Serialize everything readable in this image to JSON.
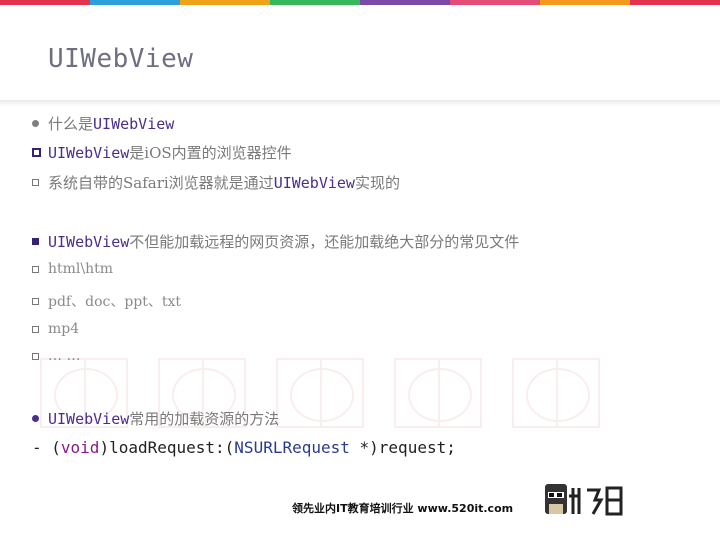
{
  "topbar_colors": [
    "#e5334f",
    "#2ea0d9",
    "#f0a21b",
    "#35b75a",
    "#7a4aa8",
    "#e44c78",
    "#f39a1e",
    "#e5334f"
  ],
  "slide": {
    "title": "UIWebView",
    "items": [
      {
        "prefix": "什么是",
        "code": "UIWebView",
        "suffix": ""
      },
      {
        "prefix": "",
        "code": "UIWebView",
        "suffix": "是iOS内置的浏览器控件"
      },
      {
        "prefix": "系统自带的Safari浏览器就是通过",
        "code": "UIWebView",
        "suffix": "实现的"
      },
      {
        "prefix": "",
        "code": "UIWebView",
        "suffix": "不但能加载远程的网页资源，还能加载绝大部分的常见文件"
      },
      {
        "text": "html\\htm"
      },
      {
        "text": "pdf、doc、ppt、txt"
      },
      {
        "text": "mp4"
      },
      {
        "text": "… …"
      },
      {
        "prefix": "",
        "code": "UIWebView",
        "suffix": "常用的加载资源的方法"
      }
    ],
    "signature": {
      "dash": "- (",
      "return_type": "void",
      "method": ")loadRequest:(",
      "param_type": "NSURLRequest",
      "param_rest": " *)request;"
    },
    "footer": "领先业内IT教育培训行业 www.520it.com"
  },
  "icons": {
    "bullet_round": "dot-bullet-icon",
    "bullet_square": "square-bullet-icon",
    "logo": "brand-logo"
  }
}
